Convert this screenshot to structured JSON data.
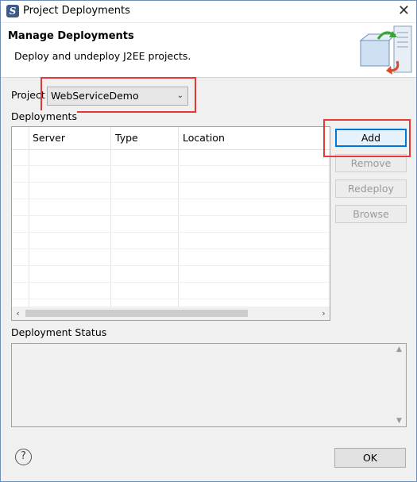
{
  "window": {
    "title": "Project Deployments"
  },
  "banner": {
    "title": "Manage Deployments",
    "description": "Deploy and undeploy J2EE projects."
  },
  "project": {
    "label": "Project",
    "selected": "WebServiceDemo"
  },
  "deployments": {
    "label": "Deployments",
    "columns": [
      "Server",
      "Type",
      "Location"
    ]
  },
  "buttons": {
    "add": "Add",
    "remove": "Remove",
    "redeploy": "Redeploy",
    "browse": "Browse"
  },
  "status": {
    "label": "Deployment Status"
  },
  "footer": {
    "ok": "OK",
    "help": "?"
  },
  "icons": {
    "app": "S",
    "close": "✕"
  }
}
